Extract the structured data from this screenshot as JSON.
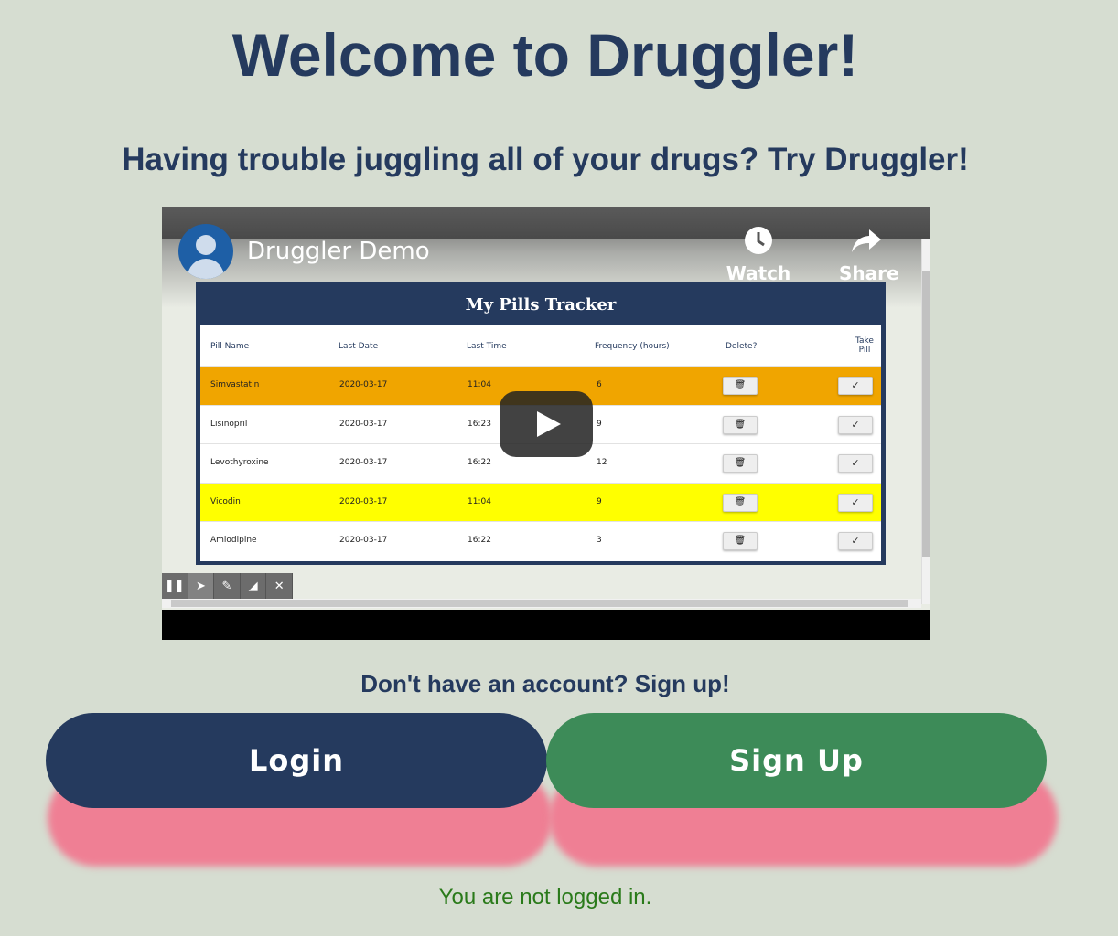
{
  "header": {
    "title": "Welcome to Druggler!",
    "subtitle": "Having trouble juggling all of your drugs? Try Druggler!"
  },
  "video": {
    "title": "Druggler Demo",
    "watch_later": "Watch later",
    "share": "Share",
    "tracker": {
      "title": "My Pills Tracker",
      "columns": [
        "Pill Name",
        "Last Date",
        "Last Time",
        "Frequency (hours)",
        "Delete?",
        "Take Pill"
      ],
      "rows": [
        {
          "name": "Simvastatin",
          "date": "2020-03-17",
          "time": "11:04",
          "freq": "6",
          "highlight": "#f0a500"
        },
        {
          "name": "Lisinopril",
          "date": "2020-03-17",
          "time": "16:23",
          "freq": "9",
          "highlight": "#ffffff"
        },
        {
          "name": "Levothyroxine",
          "date": "2020-03-17",
          "time": "16:22",
          "freq": "12",
          "highlight": "#ffffff"
        },
        {
          "name": "Vicodin",
          "date": "2020-03-17",
          "time": "11:04",
          "freq": "9",
          "highlight": "#ffff00"
        },
        {
          "name": "Amlodipine",
          "date": "2020-03-17",
          "time": "16:22",
          "freq": "3",
          "highlight": "#ffffff"
        }
      ],
      "check_glyph": "✓",
      "trash_glyph": "🗑"
    }
  },
  "auth": {
    "prompt": "Don't have an account? Sign up!",
    "login_label": "Login",
    "signup_label": "Sign Up",
    "status": "You are not logged in."
  },
  "colors": {
    "background": "#d6ddd1",
    "navy": "#253a5e",
    "green": "#3d8b58",
    "pink_shadow": "#ef7f94",
    "status_green": "#2a7a1a"
  }
}
